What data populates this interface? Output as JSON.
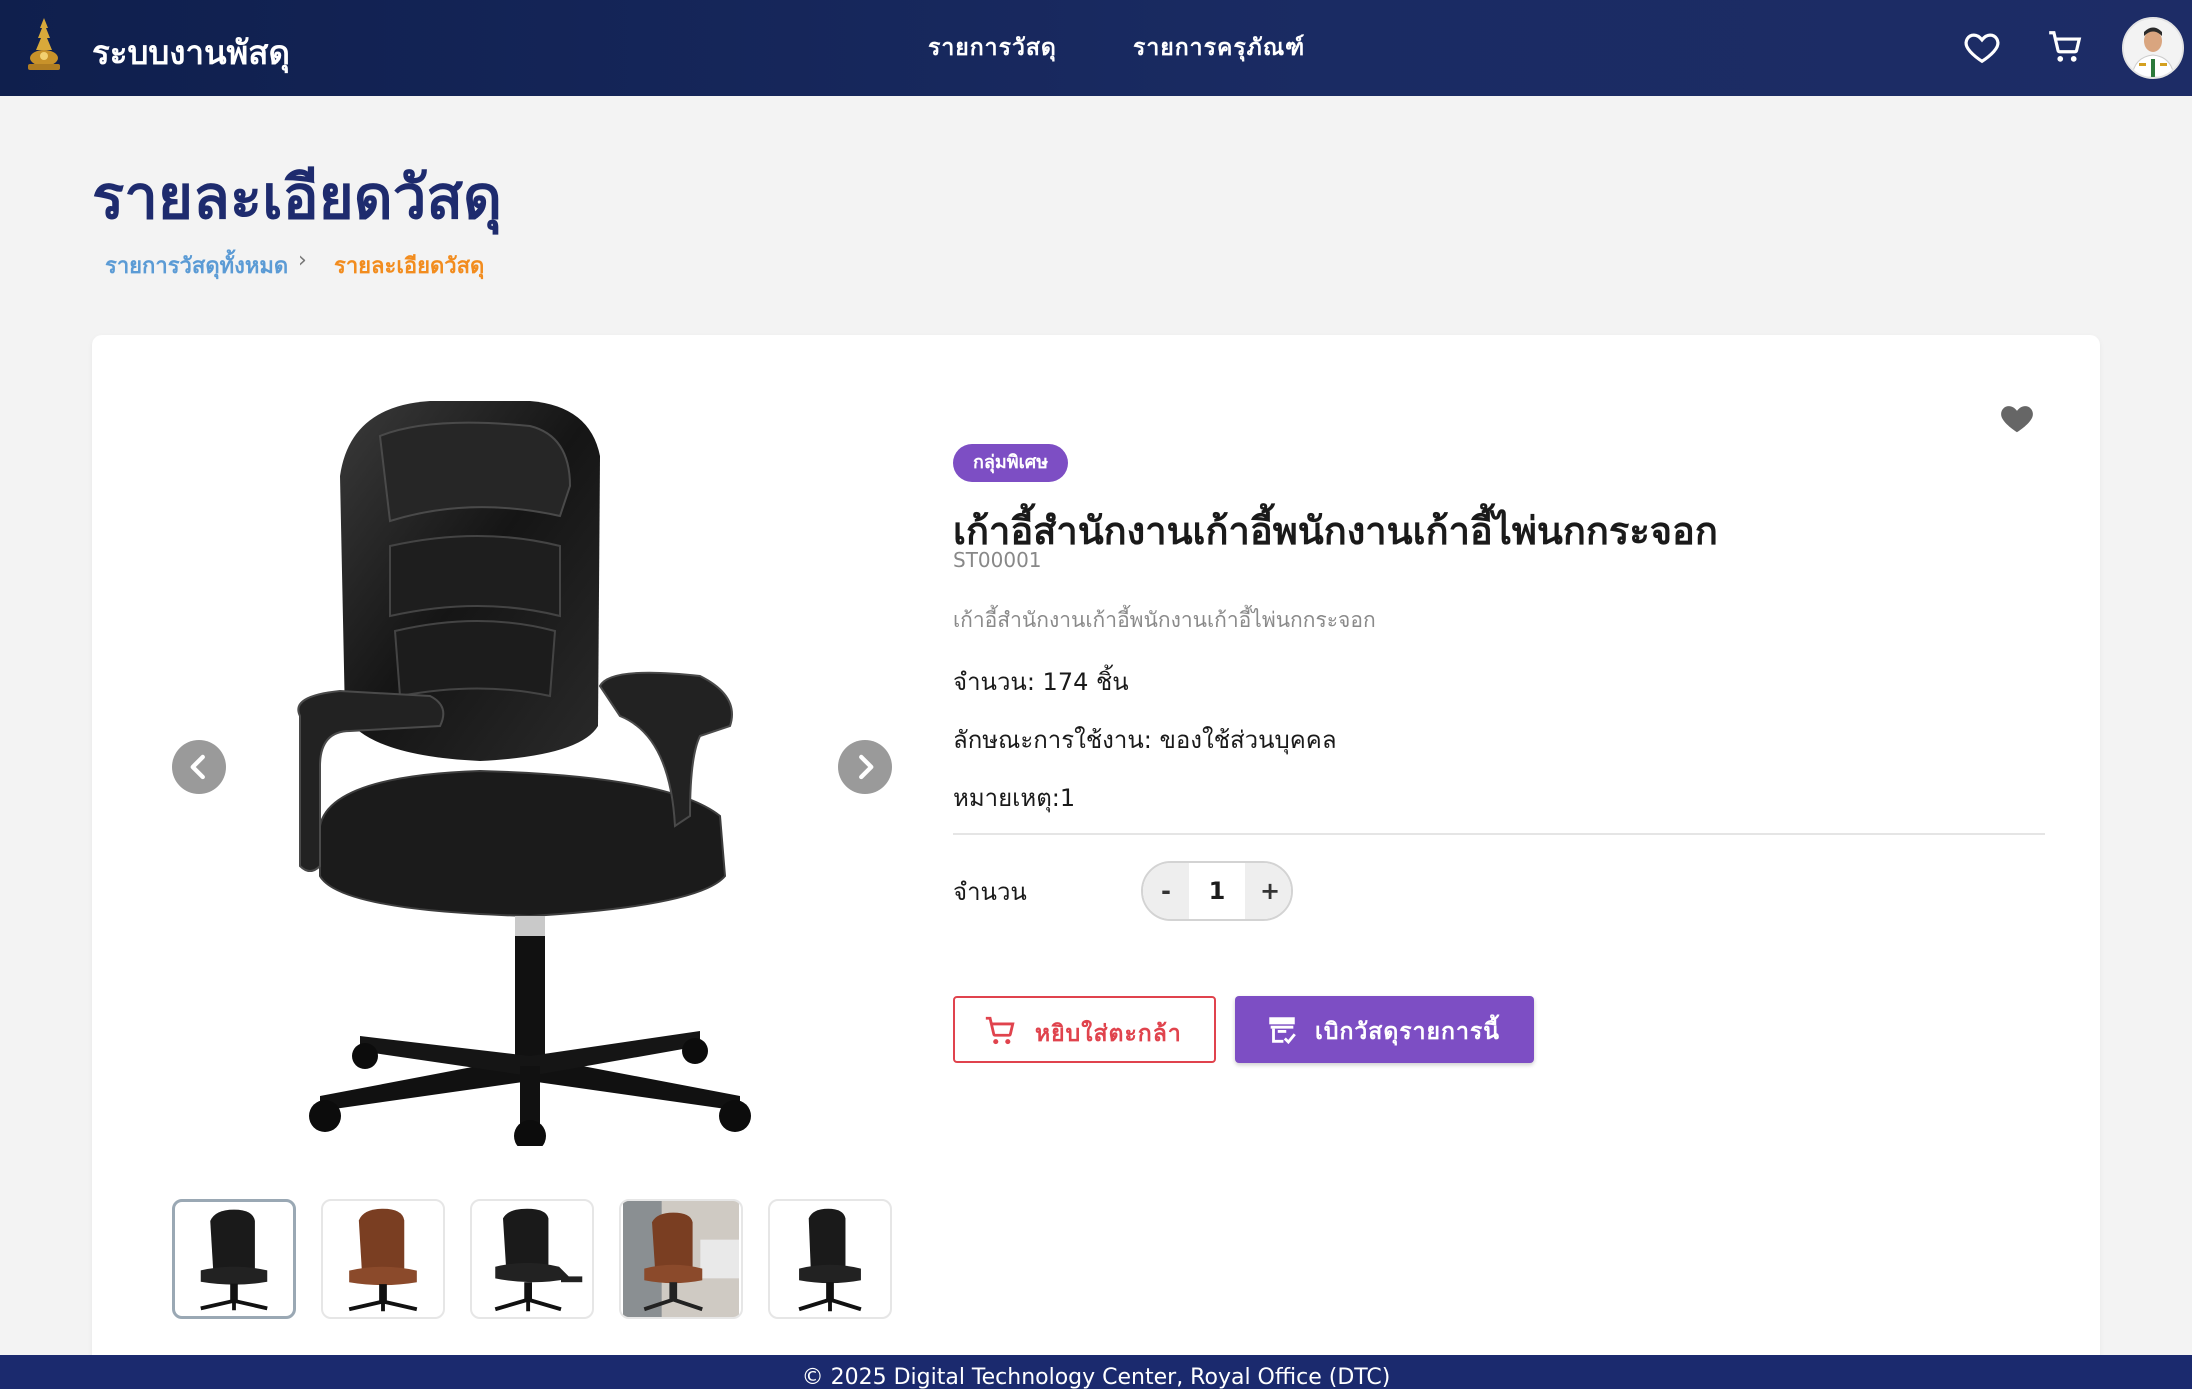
{
  "header": {
    "app_title": "ระบบงานพัสดุ",
    "nav": [
      "รายการวัสดุ",
      "รายการครุภัณฑ์"
    ],
    "icons": [
      "heart-icon",
      "cart-icon",
      "avatar"
    ]
  },
  "page": {
    "title": "รายละเอียดวัสดุ",
    "breadcrumb": [
      {
        "label": "รายการวัสดุทั้งหมด",
        "color": "#5b9bd5"
      },
      {
        "label": "รายละเอียดวัสดุ",
        "color": "#f28c1e"
      }
    ],
    "breadcrumb_separator": "›"
  },
  "product": {
    "badge": "กลุ่มพิเศษ",
    "name": "เก้าอี้สำนักงานเก้าอี้พนักงานเก้าอี้ไพ่นกกระจอก",
    "sku": "ST00001",
    "description": "เก้าอี้สำนักงานเก้าอี้พนักงานเก้าอี้ไพ่นกกระจอก",
    "quantity_line": "จำนวน: 174 ชิ้น",
    "usage_line": "ลักษณะการใช้งาน: ของใช้ส่วนบุคคล",
    "note_line": "หมายเหตุ:1",
    "images": [
      "black-chair",
      "brown-chair",
      "black-chair-footrest",
      "brown-chair-office",
      "black-chair-side"
    ],
    "active_image": 0
  },
  "order": {
    "qty_label": "จำนวน",
    "minus": "-",
    "qty_value": "1",
    "plus": "+",
    "add_to_cart": "หยิบใส่ตะกล้า",
    "request": "เบิกวัสดุรายการนี้"
  },
  "colors": {
    "header": "#1a2b63",
    "title": "#1e2b6e",
    "accent_purple": "#7d4ec4",
    "cart_red": "#e0434d"
  },
  "footer": {
    "text": "© 2025 Digital Technology Center, Royal Office (DTC)"
  }
}
